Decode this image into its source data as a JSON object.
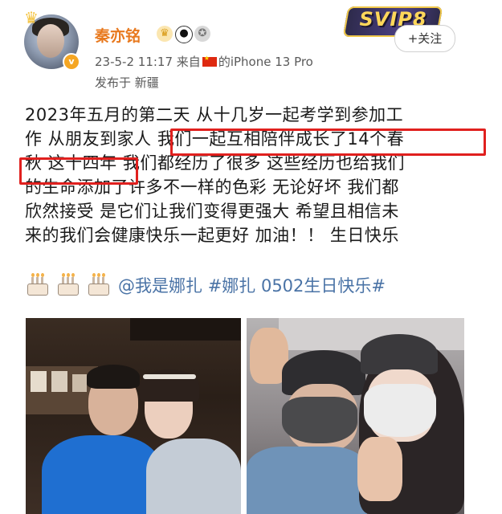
{
  "user": {
    "name": "秦亦铭",
    "date": "23-5-2",
    "time": "11:17",
    "source_prefix": "来自",
    "source_suffix": "的iPhone 13 Pro",
    "location": "发布于 新疆",
    "verified_mark": "v"
  },
  "svip": {
    "label": "SVIP8"
  },
  "follow_button": {
    "label": "+关注"
  },
  "post": {
    "lines": [
      "2023年五月的第二天 从十几岁一起考学到参加工",
      "作 从朋友到家人 我们一起互相陪伴成长了14个春",
      "秋 这十四年 我们都经历了很多 这些经历也给我们",
      "的生命添加了许多不一样的色彩 无论好坏 我们都",
      "欣然接受 是它们让我们变得更强大 希望且相信未",
      "来的我们会健康快乐一起更好 加油！！ 生日快乐"
    ],
    "mention": "@我是娜扎",
    "hashtag": "#娜扎 0502生日快乐#"
  },
  "icons": [
    "crown-icon",
    "crown-medal-icon",
    "panda-icon",
    "medal-icon",
    "flag-icon",
    "cake-icon",
    "follow-plus-icon"
  ],
  "colors": {
    "username": "#e8791e",
    "link": "#4a73a6",
    "highlight_border": "#e0201e",
    "meta_text": "#5a5a5a"
  }
}
